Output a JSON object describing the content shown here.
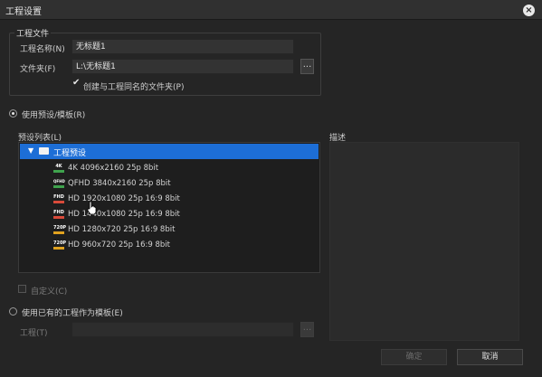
{
  "window": {
    "title": "工程设置"
  },
  "project_file": {
    "group_title": "工程文件",
    "name_label": "工程名称(N)",
    "name_value": "无标题1",
    "folder_label": "文件夹(F)",
    "folder_value": "L:\\无标题1",
    "browse_label": "...",
    "create_folder_label": "创建与工程同名的文件夹(P)",
    "create_folder_checked": true
  },
  "use_preset": {
    "label": "使用预设/模板(R)",
    "selected": true,
    "list_label": "预设列表(L)",
    "description_label": "描述",
    "tree": {
      "root_label": "工程预设",
      "items": [
        {
          "badge": "4K",
          "badge_color": "#3fa34d",
          "label": "4K 4096x2160 25p 8bit"
        },
        {
          "badge": "QFHD",
          "badge_color": "#3fa34d",
          "label": "QFHD 3840x2160 25p 8bit"
        },
        {
          "badge": "FHD",
          "badge_color": "#d94a3a",
          "label": "HD 1920x1080 25p 16:9 8bit"
        },
        {
          "badge": "FHD",
          "badge_color": "#d94a3a",
          "label": "HD 1440x1080 25p 16:9 8bit"
        },
        {
          "badge": "720P",
          "badge_color": "#e0a21f",
          "label": "HD 1280x720 25p 16:9 8bit"
        },
        {
          "badge": "720P",
          "badge_color": "#e0a21f",
          "label": "HD 960x720 25p 16:9 8bit"
        }
      ]
    },
    "custom_label": "自定义(C)"
  },
  "use_existing": {
    "label": "使用已有的工程作为模板(E)",
    "project_label": "工程(T)",
    "project_value": "",
    "browse_label": "..."
  },
  "footer": {
    "ok_label": "确定",
    "cancel_label": "取消"
  }
}
